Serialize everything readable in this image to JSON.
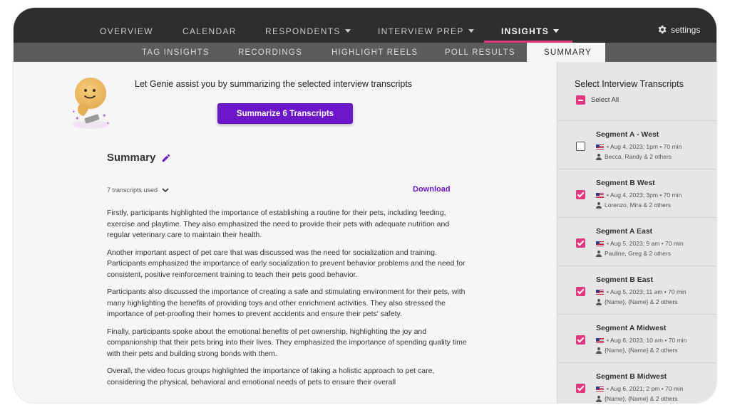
{
  "nav": {
    "items": [
      {
        "label": "OVERVIEW"
      },
      {
        "label": "CALENDAR"
      },
      {
        "label": "RESPONDENTS"
      },
      {
        "label": "INTERVIEW PREP"
      },
      {
        "label": "INSIGHTS"
      }
    ],
    "active": "INSIGHTS",
    "settings_label": "settings"
  },
  "subnav": {
    "items": [
      {
        "label": "TAG INSIGHTS"
      },
      {
        "label": "RECORDINGS"
      },
      {
        "label": "HIGHLIGHT REELS"
      },
      {
        "label": "POLL RESULTS"
      },
      {
        "label": "SUMMARY"
      }
    ],
    "active": "SUMMARY"
  },
  "main": {
    "genie_prompt": "Let Genie assist you by summarizing the selected interview transcripts",
    "summarize_button": "Summarize 6 Transcripts",
    "summary_title": "Summary",
    "transcripts_used": "7 transcripts used",
    "download_label": "Download",
    "paragraphs": [
      "Firstly, participants highlighted the importance of establishing a routine for their pets, including feeding, exercise and playtime. They also emphasized the need to provide their pets with adequate nutrition and regular veterinary care to maintain their health.",
      "Another important aspect of pet care that was discussed was the need for socialization and training. Participants emphasized the importance of early socialization to prevent behavior problems and the need for consistent, positive reinforcement training to teach their pets good behavior.",
      "Participants also discussed the importance of creating a safe and stimulating environment for their pets, with many highlighting the benefits of providing toys and other enrichment activities. They also stressed the importance of pet-proofing their homes to prevent accidents and ensure their pets' safety.",
      "Finally, participants spoke about the emotional benefits of pet ownership, highlighting the joy and companionship that their pets bring into their lives. They emphasized the importance of spending quality time with their pets and building strong bonds with them.",
      "Overall, the video focus groups highlighted the importance of taking a holistic approach to pet care, considering the physical, behavioral and emotional needs of pets to ensure their overall"
    ]
  },
  "sidebar": {
    "title": "Select Interview Transcripts",
    "select_all": "Select All",
    "segments": [
      {
        "name": "Segment A - West",
        "meta": "• Aug 4, 2023; 1pm • 70 min",
        "people": "Becca, Randy & 2 others",
        "checked": false
      },
      {
        "name": "Segment B West",
        "meta": "• Aug 4, 2023; 3pm • 70 min",
        "people": "Lorenzo, Mira & 2 others",
        "checked": true
      },
      {
        "name": "Segment A East",
        "meta": "• Aug 5, 2023; 9 am • 70 min",
        "people": "Pauline, Greg & 2 others",
        "checked": true
      },
      {
        "name": "Segment B East",
        "meta": "• Aug 5, 2023; 11 am • 70 min",
        "people": "{Name}, {Name} & 2 others",
        "checked": true
      },
      {
        "name": "Segment A Midwest",
        "meta": "• Aug 6, 2023; 10 am • 70 min",
        "people": "{Name}, {Name} & 2 others",
        "checked": true
      },
      {
        "name": "Segment B Midwest",
        "meta": "• Aug 6, 2021; 2 pm • 70 min",
        "people": "{Name}, {Name} & 2 others",
        "checked": true
      }
    ]
  },
  "colors": {
    "accent_purple": "#6b17c9",
    "accent_pink": "#e0397f",
    "nav_bg": "#2e2e2e",
    "subnav_bg": "#5b5b5b"
  }
}
